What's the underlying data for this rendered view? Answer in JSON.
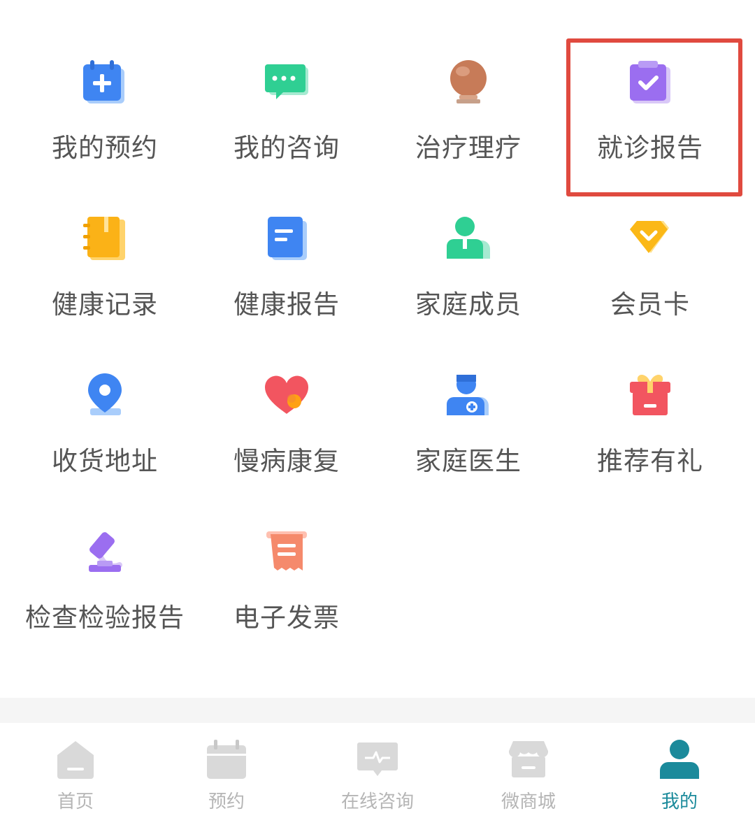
{
  "menu": {
    "items": [
      {
        "label": "我的预约",
        "icon": "calendar-plus-icon"
      },
      {
        "label": "我的咨询",
        "icon": "chat-bubble-icon"
      },
      {
        "label": "治疗理疗",
        "icon": "therapy-lamp-icon"
      },
      {
        "label": "就诊报告",
        "icon": "clipboard-check-icon"
      },
      {
        "label": "健康记录",
        "icon": "notebook-icon"
      },
      {
        "label": "健康报告",
        "icon": "document-icon"
      },
      {
        "label": "家庭成员",
        "icon": "family-member-icon"
      },
      {
        "label": "会员卡",
        "icon": "diamond-icon"
      },
      {
        "label": "收货地址",
        "icon": "location-pin-icon"
      },
      {
        "label": "慢病康复",
        "icon": "heart-icon"
      },
      {
        "label": "家庭医生",
        "icon": "doctor-icon"
      },
      {
        "label": "推荐有礼",
        "icon": "gift-icon"
      },
      {
        "label": "检查检验报告",
        "icon": "microscope-icon"
      },
      {
        "label": "电子发票",
        "icon": "receipt-icon"
      }
    ],
    "highlighted_item": "就诊报告"
  },
  "tabbar": {
    "tabs": [
      {
        "label": "首页",
        "icon": "home-icon",
        "active": false
      },
      {
        "label": "预约",
        "icon": "calendar-icon",
        "active": false
      },
      {
        "label": "在线咨询",
        "icon": "consult-icon",
        "active": false
      },
      {
        "label": "微商城",
        "icon": "shop-icon",
        "active": false
      },
      {
        "label": "我的",
        "icon": "profile-icon",
        "active": true
      }
    ]
  },
  "colors": {
    "label_text": "#555555",
    "tab_inactive": "#b5b5b5",
    "tab_active": "#1b8a9b",
    "highlight": "#e04a3f",
    "divider": "#f5f5f5"
  }
}
